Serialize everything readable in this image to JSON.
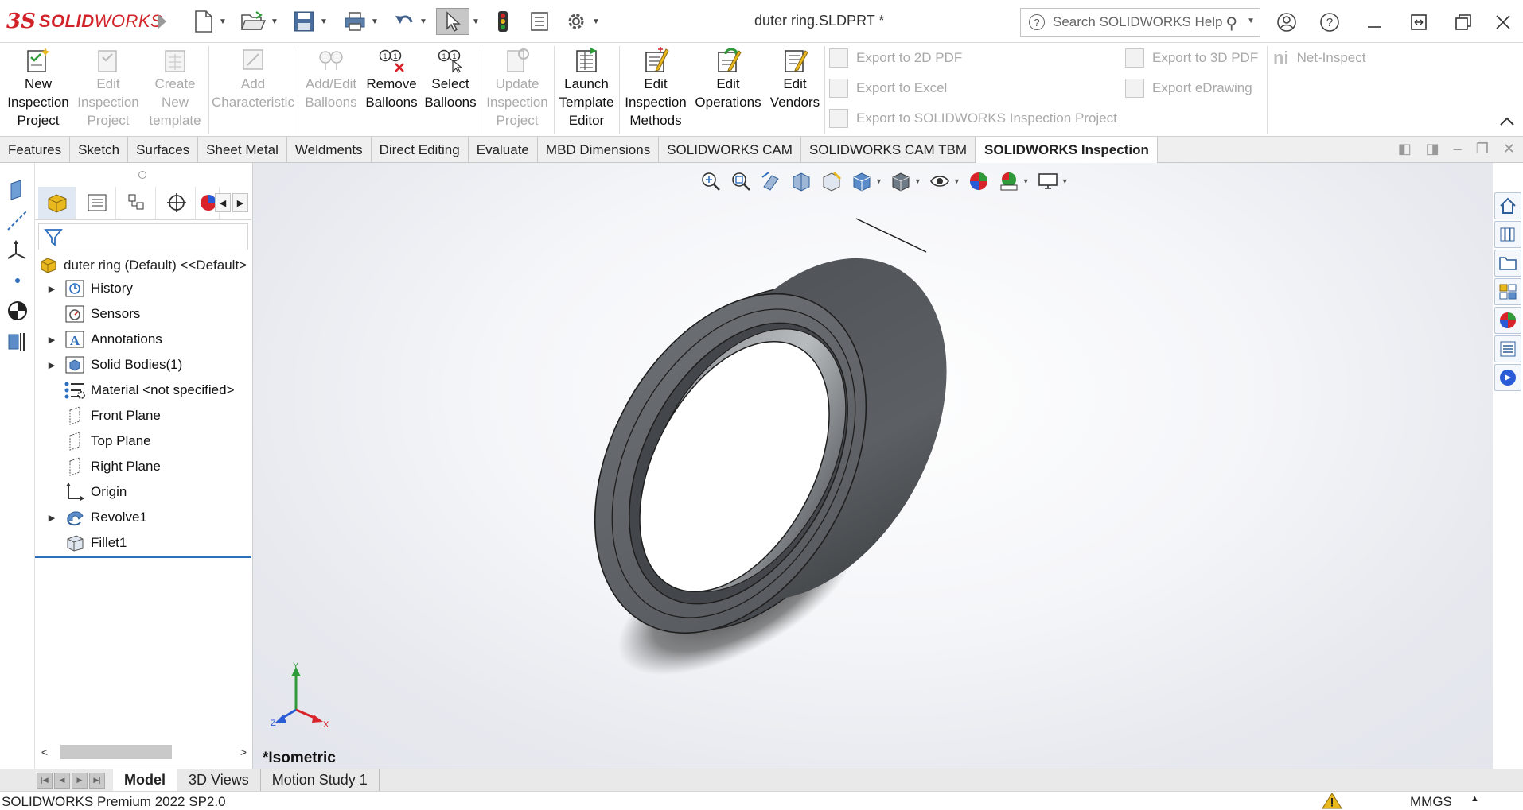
{
  "app": {
    "logo_prefix": "3S",
    "logo_bold": "SOLID",
    "logo_light": "WORKS",
    "document_title": "duter ring.SLDPRT *"
  },
  "search": {
    "placeholder": "Search SOLIDWORKS Help"
  },
  "ribbon": {
    "buttons": [
      {
        "line1": "New",
        "line2": "Inspection",
        "line3": "Project",
        "enabled": true
      },
      {
        "line1": "Edit",
        "line2": "Inspection",
        "line3": "Project",
        "enabled": false
      },
      {
        "line1": "Create",
        "line2": "New",
        "line3": "template",
        "enabled": false
      },
      {
        "line1": "Add",
        "line2": "Characteristic",
        "line3": "",
        "enabled": false
      },
      {
        "line1": "Add/Edit",
        "line2": "Balloons",
        "line3": "",
        "enabled": false
      },
      {
        "line1": "Remove",
        "line2": "Balloons",
        "line3": "",
        "enabled": true
      },
      {
        "line1": "Select",
        "line2": "Balloons",
        "line3": "",
        "enabled": true
      },
      {
        "line1": "Update",
        "line2": "Inspection",
        "line3": "Project",
        "enabled": false
      },
      {
        "line1": "Launch",
        "line2": "Template",
        "line3": "Editor",
        "enabled": true
      },
      {
        "line1": "Edit",
        "line2": "Inspection",
        "line3": "Methods",
        "enabled": true
      },
      {
        "line1": "Edit",
        "line2": "Operations",
        "line3": "",
        "enabled": true
      },
      {
        "line1": "Edit",
        "line2": "Vendors",
        "line3": "",
        "enabled": true
      }
    ],
    "exports": {
      "pdf2d": "Export to 2D PDF",
      "excel": "Export to Excel",
      "sw_inspection": "Export to SOLIDWORKS Inspection Project",
      "pdf3d": "Export to 3D PDF",
      "edrawing": "Export eDrawing",
      "net_inspect": "Net-Inspect",
      "net_inspect_logo": "ni"
    }
  },
  "command_tabs": [
    {
      "label": "Features",
      "active": false
    },
    {
      "label": "Sketch",
      "active": false
    },
    {
      "label": "Surfaces",
      "active": false
    },
    {
      "label": "Sheet Metal",
      "active": false
    },
    {
      "label": "Weldments",
      "active": false
    },
    {
      "label": "Direct Editing",
      "active": false
    },
    {
      "label": "Evaluate",
      "active": false
    },
    {
      "label": "MBD Dimensions",
      "active": false
    },
    {
      "label": "SOLIDWORKS CAM",
      "active": false
    },
    {
      "label": "SOLIDWORKS CAM TBM",
      "active": false
    },
    {
      "label": "SOLIDWORKS Inspection",
      "active": true
    }
  ],
  "feature_tree": {
    "root": "duter ring (Default) <<Default>",
    "items": [
      {
        "label": "History",
        "expandable": true,
        "icon": "history-icon"
      },
      {
        "label": "Sensors",
        "expandable": false,
        "icon": "sensors-icon"
      },
      {
        "label": "Annotations",
        "expandable": true,
        "icon": "annotations-icon"
      },
      {
        "label": "Solid Bodies(1)",
        "expandable": true,
        "icon": "solid-bodies-icon"
      },
      {
        "label": "Material <not specified>",
        "expandable": false,
        "icon": "material-icon"
      },
      {
        "label": "Front Plane",
        "expandable": false,
        "icon": "plane-icon"
      },
      {
        "label": "Top Plane",
        "expandable": false,
        "icon": "plane-icon"
      },
      {
        "label": "Right Plane",
        "expandable": false,
        "icon": "plane-icon"
      },
      {
        "label": "Origin",
        "expandable": false,
        "icon": "origin-icon"
      },
      {
        "label": "Revolve1",
        "expandable": true,
        "icon": "revolve-icon"
      },
      {
        "label": "Fillet1",
        "expandable": false,
        "icon": "fillet-icon"
      }
    ]
  },
  "viewport": {
    "view_name": "*Isometric",
    "triad": {
      "x": "X",
      "y": "Y",
      "z": "Z"
    },
    "colors": {
      "model": "#5b5f63",
      "x_axis": "#d9232a",
      "y_axis": "#2e9a3a",
      "z_axis": "#2a5bd6"
    }
  },
  "bottom_tabs": [
    {
      "label": "Model",
      "active": true
    },
    {
      "label": "3D Views",
      "active": false
    },
    {
      "label": "Motion Study 1",
      "active": false
    }
  ],
  "status": {
    "product": "SOLIDWORKS Premium 2022 SP2.0",
    "units": "MMGS"
  }
}
